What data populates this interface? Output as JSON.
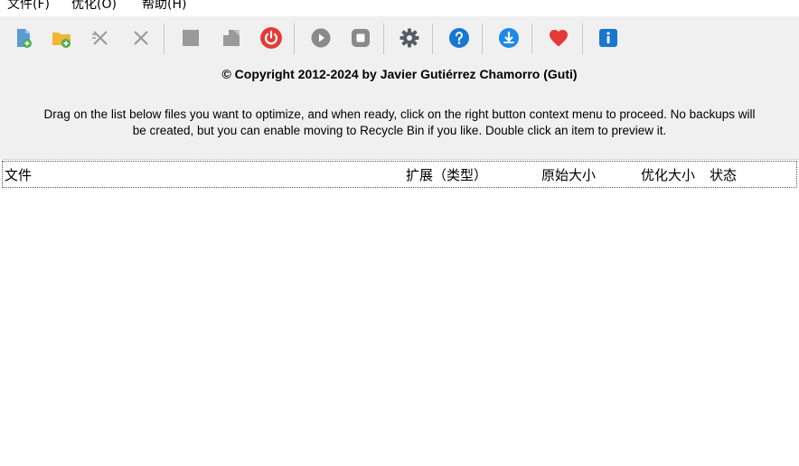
{
  "menu": {
    "file": "文件(F)",
    "optimize": "优化(O)",
    "help": "帮助(H)"
  },
  "toolbar": {
    "buttons": [
      {
        "name": "add-file-icon"
      },
      {
        "name": "add-folder-icon"
      },
      {
        "name": "remove-selected-icon"
      },
      {
        "name": "clear-list-icon"
      },
      {
        "name": "stop-square-icon"
      },
      {
        "name": "export-icon"
      },
      {
        "name": "power-icon"
      },
      {
        "name": "play-icon"
      },
      {
        "name": "stop-icon"
      },
      {
        "name": "settings-gear-icon"
      },
      {
        "name": "help-icon"
      },
      {
        "name": "update-icon"
      },
      {
        "name": "donate-heart-icon"
      },
      {
        "name": "about-info-icon"
      }
    ]
  },
  "copyright": "© Copyright 2012-2024 by Javier Gutiérrez Chamorro (Guti)",
  "instructions": {
    "line1": "Drag on the list below files you want to optimize, and when ready, click on the right button context menu to proceed. No backups will",
    "line2": "be created, but you can enable moving to Recycle Bin if you like. Double click an item to preview it."
  },
  "list": {
    "columns": {
      "file": "文件",
      "extension": "扩展（类型）",
      "original_size": "原始大小",
      "optimized_size": "优化大小",
      "status": "状态"
    }
  },
  "colors": {
    "toolbar_bg": "#f0f0f0",
    "power_red": "#e53935",
    "help_blue": "#1976d2",
    "heart_red": "#e53935",
    "gray_icon": "#8a8a8a"
  }
}
